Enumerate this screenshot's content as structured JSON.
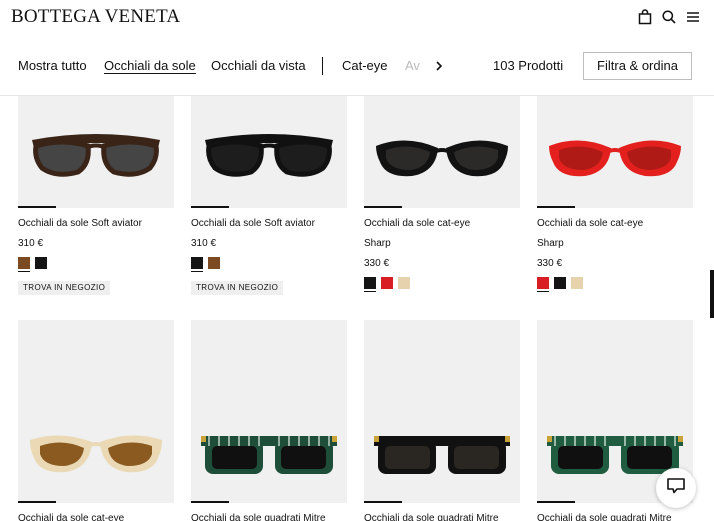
{
  "brand": {
    "logo": "BOTTEGA VENETA"
  },
  "header_icons": [
    "bag-icon",
    "search-icon",
    "menu-icon"
  ],
  "categories": [
    {
      "label": "Mostra tutto",
      "active": false
    },
    {
      "label": "Occhiali da sole",
      "active": true
    },
    {
      "label": "Occhiali da vista",
      "active": false
    },
    {
      "label": "Cat-eye",
      "active": false
    },
    {
      "label": "Av",
      "active": false
    }
  ],
  "product_count": "103 Prodotti",
  "filter_button": "Filtra & ordina",
  "products": [
    {
      "title": "Occhiali da sole Soft aviator",
      "price": "310 €",
      "swatches": [
        "#7b4a22",
        "#151515"
      ],
      "badge": "TROVA IN NEGOZIO",
      "frame": "#3a2418",
      "lens": "#4a4a4a"
    },
    {
      "title": "Occhiali da sole Soft aviator",
      "price": "310 €",
      "swatches": [
        "#151515",
        "#7b4a22"
      ],
      "badge": "TROVA IN NEGOZIO",
      "frame": "#111111",
      "lens": "#1c1c1c"
    },
    {
      "title": "Occhiali da sole cat-eye",
      "subtitle": "Sharp",
      "price": "330 €",
      "swatches": [
        "#151515",
        "#d81e24",
        "#e6d3ae"
      ],
      "frame": "#121212",
      "lens": "#2a2a2a"
    },
    {
      "title": "Occhiali da sole cat-eye",
      "subtitle": "Sharp",
      "price": "330 €",
      "swatches": [
        "#d81e24",
        "#151515",
        "#e6d3ae"
      ],
      "frame": "#e3201d",
      "lens": "#a81512"
    },
    {
      "title": "Occhiali da sole cat-eye",
      "frame": "#ead9b4",
      "lens": "#8a5a20"
    },
    {
      "title": "Occhiali da sole quadrati Mitre",
      "frame": "#1e4d3a",
      "lens": "#101010"
    },
    {
      "title": "Occhiali da sole quadrati Mitre",
      "frame": "#111111",
      "lens": "#2a2622"
    },
    {
      "title": "Occhiali da sole quadrati Mitre",
      "frame": "#1f5c40",
      "lens": "#101010"
    }
  ],
  "colors": {
    "text": "#111111",
    "image_bg": "#eff0ef",
    "badge_bg": "#efefef"
  }
}
